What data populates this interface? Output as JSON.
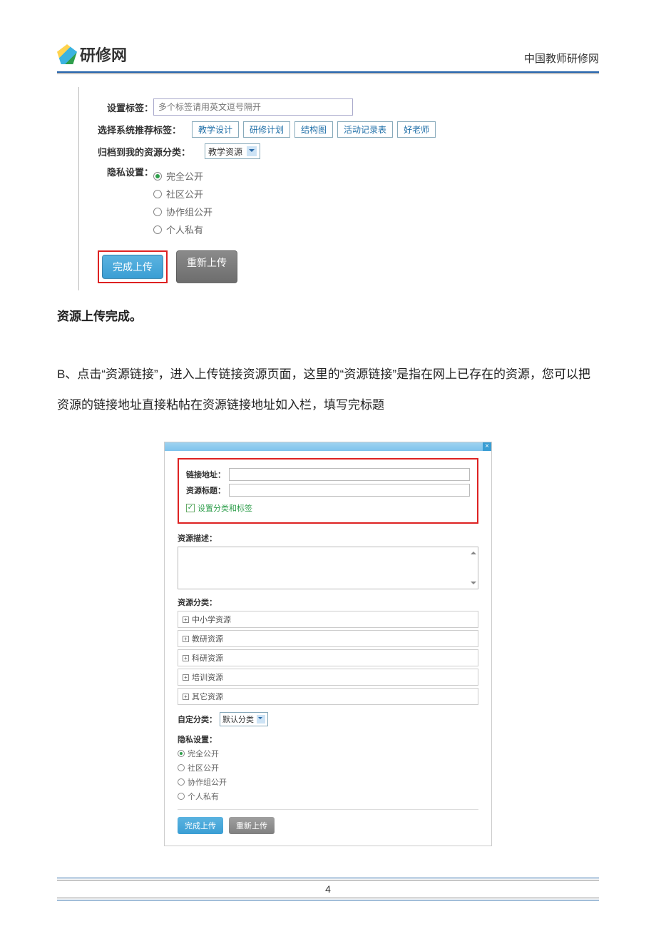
{
  "header": {
    "logo_text": "研修网",
    "right_text": "中国教师研修网"
  },
  "panel1": {
    "tags_label": "设置标签：",
    "tags_placeholder": "多个标签请用英文逗号隔开",
    "sys_tags_label": "选择系统推荐标签：",
    "sys_tags": [
      "教学设计",
      "研修计划",
      "结构图",
      "活动记录表",
      "好老师"
    ],
    "archive_label": "归档到我的资源分类：",
    "archive_value": "教学资源",
    "privacy_label": "隐私设置：",
    "privacy_options": [
      "完全公开",
      "社区公开",
      "协作组公开",
      "个人私有"
    ],
    "privacy_selected_index": 0,
    "btn_complete": "完成上传",
    "btn_reset": "重新上传"
  },
  "text": {
    "done_line": "资源上传完成。",
    "para_b": "B、点击“资源链接”，进入上传链接资源页面，这里的“资源链接”是指在网上已存在的资源，您可以把资源的链接地址直接粘帖在资源链接地址如入栏，填写完标题"
  },
  "panel2": {
    "link_addr_label": "链接地址：",
    "res_title_label": "资源标题：",
    "set_cat_tag_label": "设置分类和标签",
    "desc_label": "资源描述：",
    "cat_label": "资源分类：",
    "categories": [
      "中小学资源",
      "教研资源",
      "科研资源",
      "培训资源",
      "其它资源"
    ],
    "custom_cat_label": "自定分类：",
    "custom_cat_value": "默认分类",
    "privacy_label": "隐私设置：",
    "privacy_options": [
      "完全公开",
      "社区公开",
      "协作组公开",
      "个人私有"
    ],
    "privacy_selected_index": 0,
    "btn_complete": "完成上传",
    "btn_reset": "重新上传"
  },
  "footer": {
    "page_num": "4"
  }
}
